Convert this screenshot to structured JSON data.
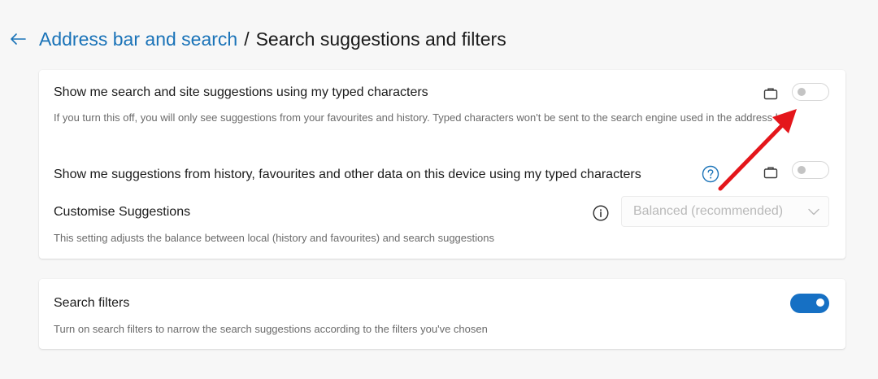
{
  "header": {
    "parent_link": "Address bar and search",
    "separator": "/",
    "current_page": "Search suggestions and filters"
  },
  "settings": {
    "typed_suggestions": {
      "title": "Show me search and site suggestions using my typed characters",
      "description": "If you turn this off, you will only see suggestions from your favourites and history. Typed characters won't be sent to the search engine used in the address bar.",
      "enabled": false
    },
    "device_suggestions": {
      "title": "Show me suggestions from history, favourites and other data on this device using my typed characters",
      "enabled": false
    },
    "customise": {
      "title": "Customise Suggestions",
      "description": "This setting adjusts the balance between local (history and favourites) and search suggestions",
      "dropdown_value": "Balanced (recommended)"
    },
    "search_filters": {
      "title": "Search filters",
      "description": "Turn on search filters to narrow the search suggestions according to the filters you've chosen",
      "enabled": true
    }
  },
  "colors": {
    "link": "#1a73b8",
    "toggle_on": "#1670c4",
    "annotation_arrow": "#e4161b"
  },
  "icons": {
    "back": "arrow-left-icon",
    "managed": "briefcase-icon",
    "help": "question-circle-icon",
    "info": "info-circle-icon",
    "dropdown": "chevron-down-icon",
    "annotation": "red-arrow-icon"
  }
}
